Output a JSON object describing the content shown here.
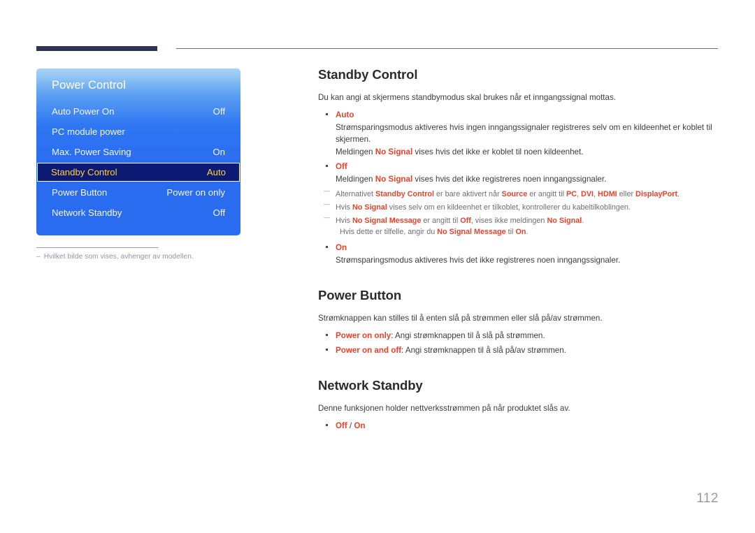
{
  "header": {
    "bar_color": "#2e3352",
    "rule_color": "#6b6f85"
  },
  "osd": {
    "title": "Power Control",
    "rows": [
      {
        "label": "Auto Power On",
        "value": "Off",
        "selected": false
      },
      {
        "label": "PC module power",
        "value": "",
        "selected": false
      },
      {
        "label": "Max. Power Saving",
        "value": "On",
        "selected": false
      },
      {
        "label": "Standby Control",
        "value": "Auto",
        "selected": true
      },
      {
        "label": "Power Button",
        "value": "Power on only",
        "selected": false
      },
      {
        "label": "Network Standby",
        "value": "Off",
        "selected": false
      }
    ],
    "note": {
      "dash": "–",
      "text": "Hvilket bilde som vises, avhenger av modellen."
    }
  },
  "sections": [
    {
      "title": "Standby Control",
      "lead": "Du kan angi at skjermens standbymodus skal brukes når et inngangssignal mottas.",
      "items": [
        {
          "option": "Auto",
          "lines": [
            "Strømsparingsmodus aktiveres hvis ingen inngangssignaler registreres selv om en kildeenhet er koblet til skjermen.",
            "Meldingen No Signal vises hvis det ikke er koblet til noen kildeenhet."
          ],
          "line_keywords": [
            [],
            [
              "No Signal"
            ]
          ]
        },
        {
          "option": "Off",
          "lines": [
            "Meldingen No Signal vises hvis det ikke registreres noen inngangssignaler."
          ],
          "line_keywords": [
            [
              "No Signal"
            ]
          ]
        }
      ],
      "notes": [
        {
          "text": "Alternativet Standby Control er bare aktivert når Source er angitt til PC, DVI, HDMI eller DisplayPort.",
          "keywords": [
            "Standby Control",
            "Source",
            "PC",
            "DVI",
            "HDMI",
            "DisplayPort"
          ]
        },
        {
          "text": "Hvis No Signal vises selv om en kildeenhet er tilkoblet, kontrollerer du kabeltilkoblingen.",
          "keywords": [
            "No Signal"
          ]
        },
        {
          "text": "Hvis No Signal Message er angitt til Off, vises ikke meldingen No Signal.",
          "subtext": "Hvis dette er tilfelle, angir du No Signal Message til On.",
          "keywords": [
            "No Signal Message",
            "Off",
            "No Signal",
            "On"
          ]
        }
      ],
      "items_after": [
        {
          "option": "On",
          "lines": [
            "Strømsparingsmodus aktiveres hvis det ikke registreres noen inngangssignaler."
          ],
          "line_keywords": [
            []
          ]
        }
      ]
    },
    {
      "title": "Power Button",
      "lead": "Strømknappen kan stilles til å enten slå på strømmen eller slå på/av strømmen.",
      "inline_items": [
        {
          "option": "Power on only",
          "rest": ": Angi strømknappen til å slå på strømmen."
        },
        {
          "option": "Power on and off",
          "rest": ": Angi strømknappen til å slå på/av strømmen."
        }
      ]
    },
    {
      "title": "Network Standby",
      "lead": "Denne funksjonen holder nettverksstrømmen på når produktet slås av.",
      "choice": {
        "first": "Off",
        "separator": " / ",
        "second": "On"
      }
    }
  ],
  "page_number": "112",
  "colors": {
    "accent_red": "#e8432a",
    "osd_highlight_bg": "#0d1a73",
    "osd_highlight_text": "#ffd23a",
    "osd_blue": "#2a6cf0",
    "header_navy": "#2e3352"
  }
}
